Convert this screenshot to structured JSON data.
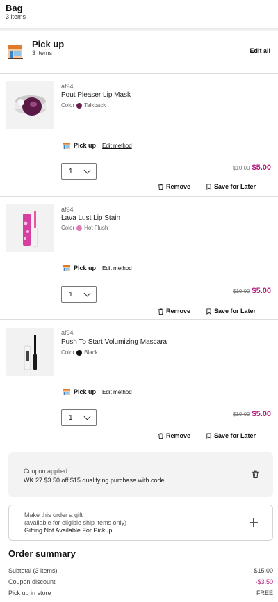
{
  "header": {
    "title": "Bag",
    "subtitle": "3 items"
  },
  "pickup": {
    "title": "Pick up",
    "subtitle": "3 items",
    "edit_all": "Edit all"
  },
  "colors": {
    "accent": "#b5197f",
    "divider": "#dddddd"
  },
  "items": [
    {
      "brand": "af94",
      "name": "Pout Pleaser Lip Mask",
      "color_label": "Color",
      "color_name": "Talkback",
      "swatch": "#6b1f4a",
      "method_label": "Pick up",
      "edit_method": "Edit method",
      "qty": "1",
      "old_price": "$10.00",
      "price": "$5.00",
      "remove": "Remove",
      "save_later": "Save for Later",
      "image_icon": "lip-mask-jar-icon"
    },
    {
      "brand": "af94",
      "name": "Lava Lust Lip Stain",
      "color_label": "Color",
      "color_name": "Hot Flush",
      "swatch": "#e07bb5",
      "method_label": "Pick up",
      "edit_method": "Edit method",
      "qty": "1",
      "old_price": "$10.00",
      "price": "$5.00",
      "remove": "Remove",
      "save_later": "Save for Later",
      "image_icon": "lip-stain-tube-icon"
    },
    {
      "brand": "af94",
      "name": "Push To Start Volumizing Mascara",
      "color_label": "Color",
      "color_name": "Black",
      "swatch": "#111111",
      "method_label": "Pick up",
      "edit_method": "Edit method",
      "qty": "1",
      "old_price": "$10.00",
      "price": "$5.00",
      "remove": "Remove",
      "save_later": "Save for Later",
      "image_icon": "mascara-tube-icon"
    }
  ],
  "coupon": {
    "label": "Coupon applied",
    "text": "WK 27 $3.50 off $15 qualifying purchase with code"
  },
  "gift": {
    "line1": "Make this order a gift",
    "line2": "(available for eligible ship items only)",
    "line3": "Gifting Not Available For Pickup"
  },
  "summary": {
    "title": "Order summary",
    "rows": [
      {
        "label": "Subtotal (3 items)",
        "value": "$15.00"
      },
      {
        "label": "Coupon discount",
        "value": "-$3.50"
      },
      {
        "label": "Pick up in store",
        "value": "FREE"
      }
    ]
  }
}
